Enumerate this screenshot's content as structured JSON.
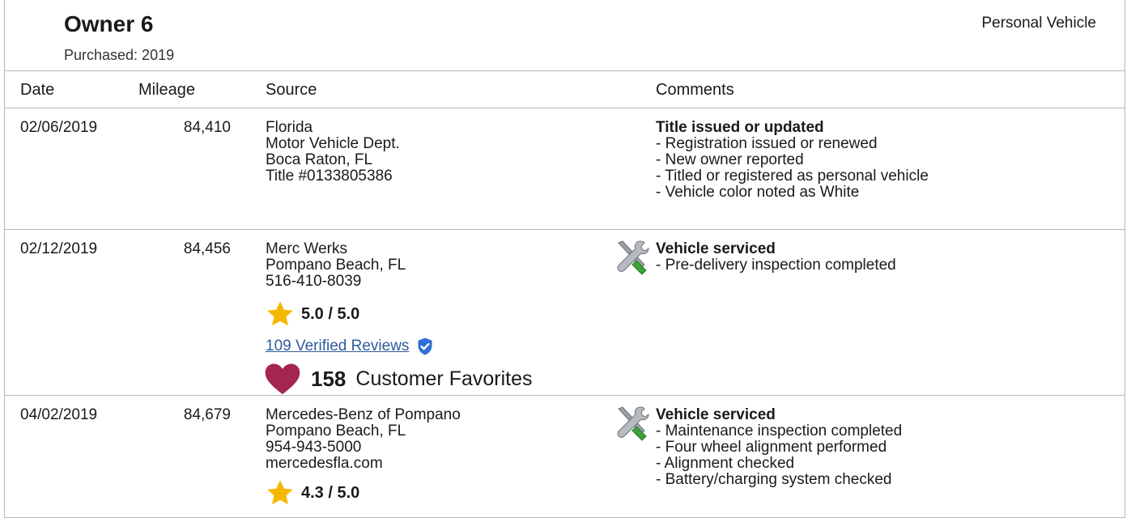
{
  "owner": {
    "title": "Owner 6",
    "purchased": "Purchased: 2019",
    "vehicle_type": "Personal Vehicle"
  },
  "columns": [
    "Date",
    "Mileage",
    "Source",
    "Comments"
  ],
  "rows": [
    {
      "date": "02/06/2019",
      "mileage": "84,410",
      "source": [
        "Florida",
        "Motor Vehicle Dept.",
        "Boca Raton, FL",
        "Title #0133805386"
      ],
      "comment_head": "Title issued or updated",
      "comments": [
        "- Registration issued or renewed",
        "- New owner reported",
        "- Titled or registered as personal vehicle",
        "- Vehicle color noted as White"
      ]
    },
    {
      "date": "02/12/2019",
      "mileage": "84,456",
      "source": [
        "Merc Werks",
        "Pompano Beach, FL",
        "516-410-8039"
      ],
      "rating": "5.0 / 5.0",
      "reviews": "109 Verified Reviews",
      "favorites_count": "158",
      "favorites_label": "Customer Favorites",
      "comment_head": "Vehicle serviced",
      "comments": [
        "- Pre-delivery inspection completed"
      ]
    },
    {
      "date": "04/02/2019",
      "mileage": "84,679",
      "source": [
        "Mercedes-Benz of Pompano",
        "Pompano Beach, FL",
        "954-943-5000",
        "mercedesfla.com"
      ],
      "rating": "4.3 / 5.0",
      "comment_head": "Vehicle serviced",
      "comments": [
        "- Maintenance inspection completed",
        "- Four wheel alignment performed",
        "- Alignment checked",
        "- Battery/charging system checked"
      ]
    }
  ],
  "icons": {
    "service": "wrench-screwdriver-icon",
    "star": "star-icon",
    "shield": "verified-shield-icon",
    "heart": "heart-icon"
  },
  "colors": {
    "star": "#f5b800",
    "heart": "#a3264f",
    "link": "#2e5c9b",
    "shield": "#2f6fd6"
  }
}
